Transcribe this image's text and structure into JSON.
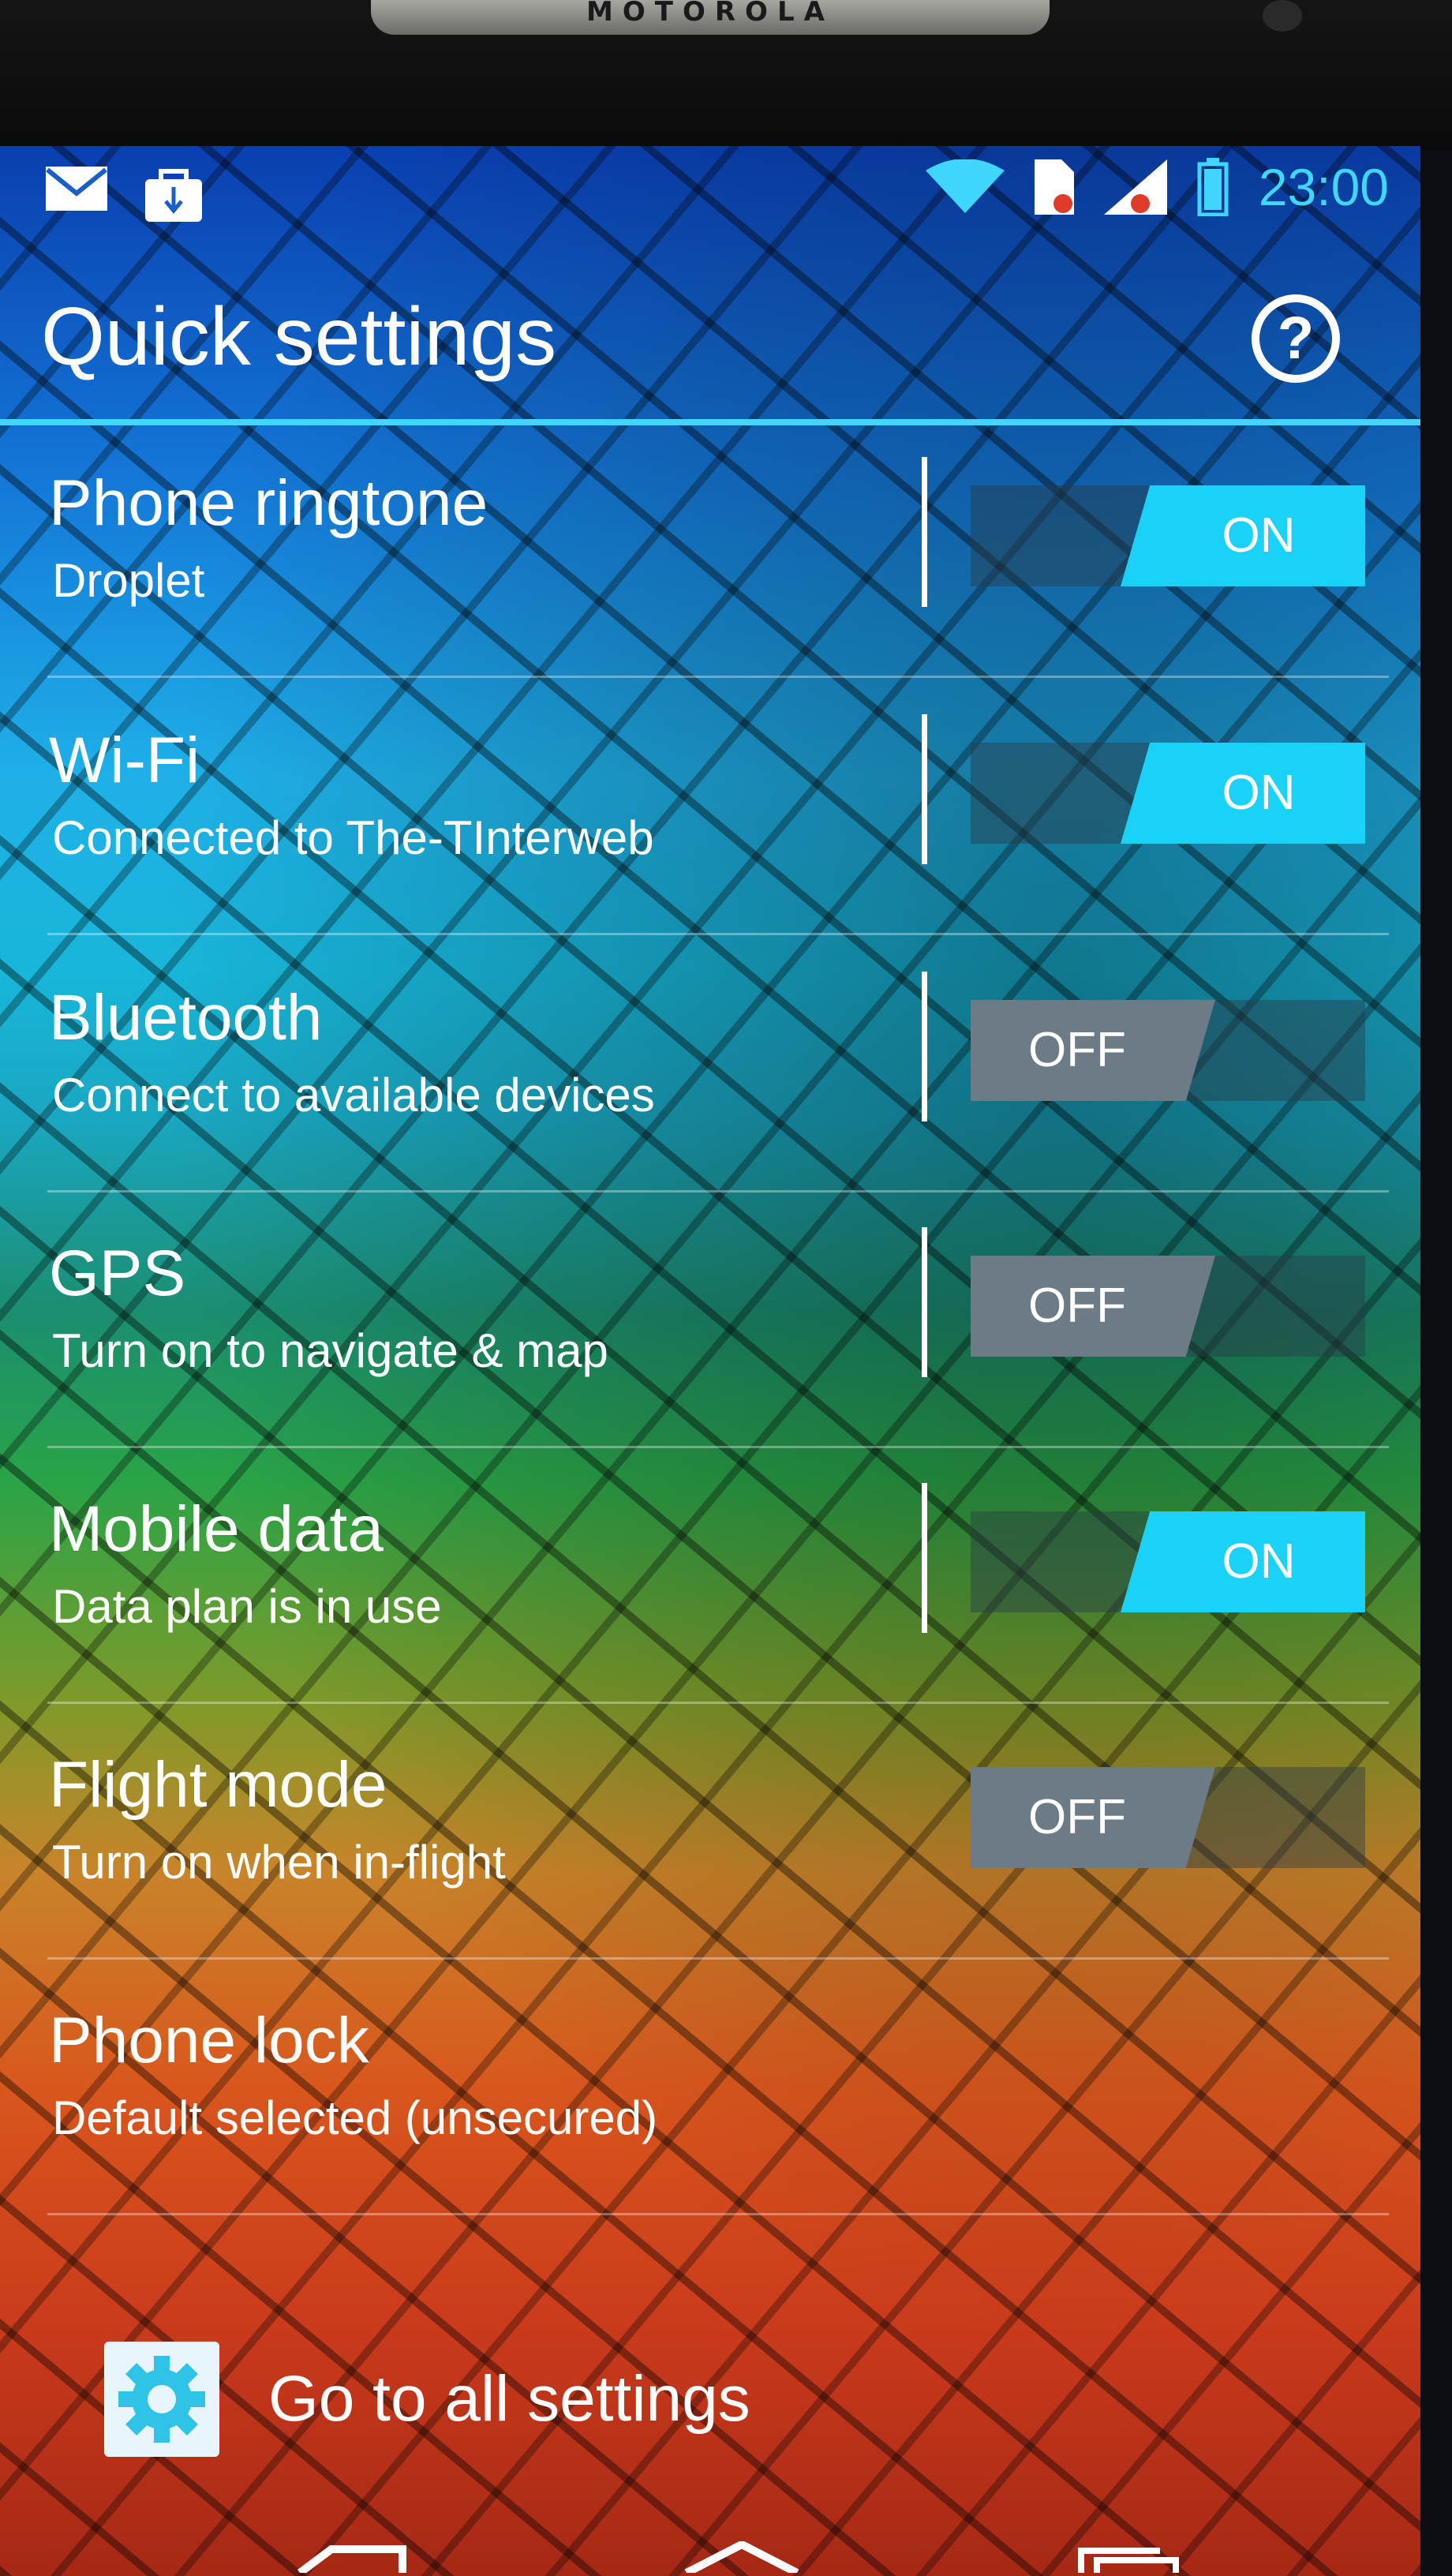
{
  "bezel": {
    "brand": "MOTOROLA"
  },
  "status_bar": {
    "left_icons": [
      "gmail-icon",
      "download-bag-icon"
    ],
    "right_icons": [
      "wifi-icon",
      "sim-icon",
      "signal-icon",
      "battery-icon"
    ],
    "time": "23:00"
  },
  "header": {
    "title": "Quick settings",
    "help_icon": "?"
  },
  "settings": [
    {
      "title": "Phone ringtone",
      "subtitle": "Droplet",
      "toggle": "ON"
    },
    {
      "title": "Wi-Fi",
      "subtitle": "Connected to The-TInterweb",
      "toggle": "ON"
    },
    {
      "title": "Bluetooth",
      "subtitle": "Connect to available devices",
      "toggle": "OFF"
    },
    {
      "title": "GPS",
      "subtitle": "Turn on to navigate & map",
      "toggle": "OFF"
    },
    {
      "title": "Mobile data",
      "subtitle": "Data plan is in use",
      "toggle": "ON"
    },
    {
      "title": "Flight mode",
      "subtitle": "Turn on when in-flight",
      "toggle": "OFF"
    },
    {
      "title": "Phone lock",
      "subtitle": "Default selected (unsecured)",
      "toggle": ""
    }
  ],
  "all_settings": {
    "label": "Go to all settings"
  },
  "colors": {
    "accent": "#1ad2f5",
    "clock": "#3fd6ff",
    "off_knob": "#6d7b86"
  }
}
